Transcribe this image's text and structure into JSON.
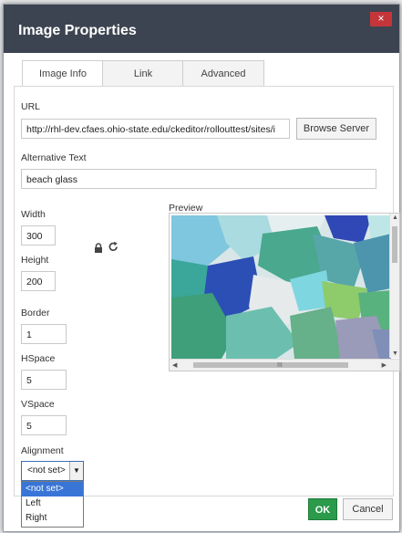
{
  "dialog": {
    "title": "Image Properties",
    "close_label": "×"
  },
  "tabs": [
    {
      "label": "Image Info",
      "active": true
    },
    {
      "label": "Link",
      "active": false
    },
    {
      "label": "Advanced",
      "active": false
    }
  ],
  "url": {
    "label": "URL",
    "value": "http://rhl-dev.cfaes.ohio-state.edu/ckeditor/rollouttest/sites/i",
    "browse_label": "Browse Server"
  },
  "alt_text": {
    "label": "Alternative Text",
    "value": "beach glass"
  },
  "width": {
    "label": "Width",
    "value": "300"
  },
  "height": {
    "label": "Height",
    "value": "200"
  },
  "border": {
    "label": "Border",
    "value": "1"
  },
  "hspace": {
    "label": "HSpace",
    "value": "5"
  },
  "vspace": {
    "label": "VSpace",
    "value": "5"
  },
  "preview": {
    "label": "Preview",
    "hscroll_mark": "III"
  },
  "alignment": {
    "label": "Alignment",
    "selected": "<not set>",
    "options": [
      "<not set>",
      "Left",
      "Right"
    ]
  },
  "footer": {
    "ok_label": "OK",
    "cancel_label": "Cancel"
  },
  "icons": {
    "lock": "lock-icon",
    "reset": "reset-size-icon"
  },
  "colors": {
    "titlebar": "#3d4451",
    "ok": "#2b9a4b",
    "close": "#c5363b",
    "selection": "#3875d7"
  }
}
